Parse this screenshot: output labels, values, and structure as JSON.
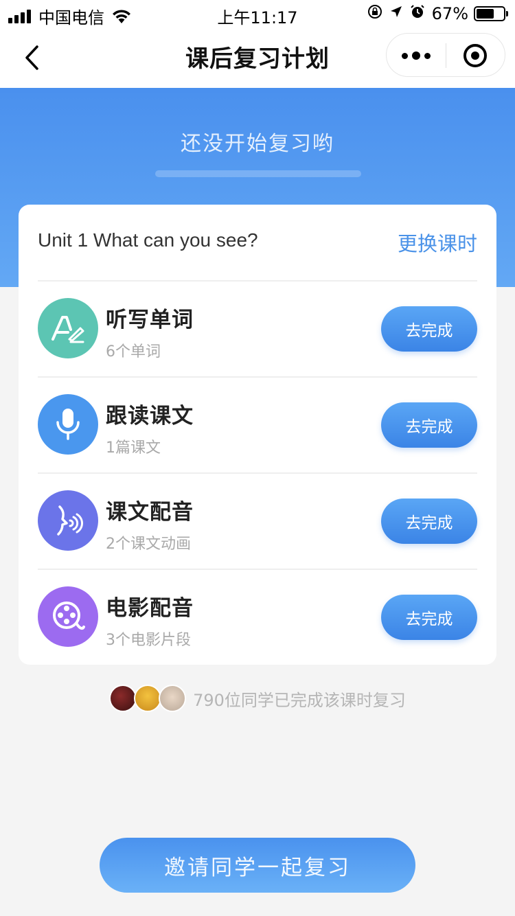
{
  "status_bar": {
    "carrier": "中国电信",
    "time": "上午11:17",
    "battery_percent": "67%",
    "battery_level": 0.67
  },
  "nav": {
    "title": "课后复习计划"
  },
  "hero": {
    "message": "还没开始复习哟",
    "progress": 0
  },
  "card": {
    "unit_title": "Unit 1 What can you see?",
    "change_label": "更换课时",
    "tasks": [
      {
        "name": "听写单词",
        "sub": "6个单词",
        "button": "去完成",
        "icon": "dictation-icon",
        "color": "#5cc5b3"
      },
      {
        "name": "跟读课文",
        "sub": "1篇课文",
        "button": "去完成",
        "icon": "microphone-icon",
        "color": "#4a97ee"
      },
      {
        "name": "课文配音",
        "sub": "2个课文动画",
        "button": "去完成",
        "icon": "voice-face-icon",
        "color": "#6b74e9"
      },
      {
        "name": "电影配音",
        "sub": "3个电影片段",
        "button": "去完成",
        "icon": "film-reel-icon",
        "color": "#9c6bf0"
      }
    ]
  },
  "completed": {
    "text": "790位同学已完成该课时复习"
  },
  "invite": {
    "label": "邀请同学一起复习"
  }
}
